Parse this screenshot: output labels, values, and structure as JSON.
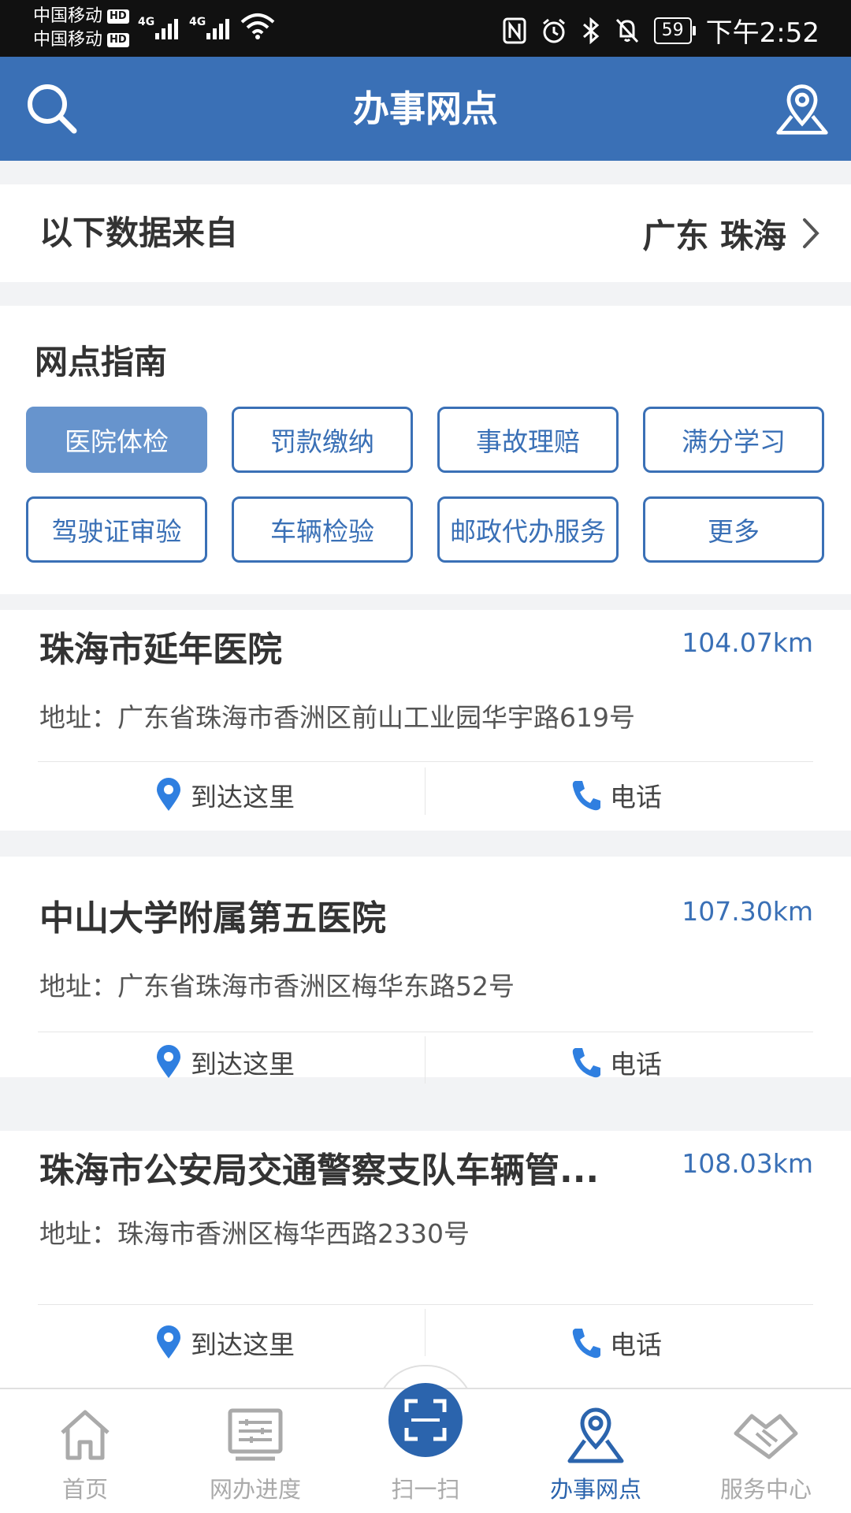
{
  "status_bar": {
    "carrier1": "中国移动",
    "carrier2": "中国移动",
    "hd": "HD",
    "net1": "4G",
    "net2": "4G",
    "battery": "59",
    "time": "下午2:52"
  },
  "header": {
    "title": "办事网点",
    "left_icon": "search-icon",
    "right_icon": "map-pin-icon",
    "bg_color": "#3a70b6"
  },
  "source": {
    "label": "以下数据来自",
    "location": "广东 珠海"
  },
  "guide": {
    "title": "网点指南",
    "chips": [
      "医院体检",
      "罚款缴纳",
      "事故理赔",
      "满分学习",
      "驾驶证审验",
      "车辆检验",
      "邮政代办服务",
      "更多"
    ],
    "active_chip": "医院体检"
  },
  "list": [
    {
      "name": "珠海市延年医院",
      "distance": "104.07km",
      "address": "地址：广东省珠海市香洲区前山工业园华宇路619号",
      "nav_label": "到达这里",
      "phone_label": "电话"
    },
    {
      "name": "中山大学附属第五医院",
      "distance": "107.30km",
      "address": "地址：广东省珠海市香洲区梅华东路52号",
      "nav_label": "到达这里",
      "phone_label": "电话"
    },
    {
      "name": "珠海市公安局交通警察支队车辆管...",
      "distance": "108.03km",
      "address": "地址：珠海市香洲区梅华西路2330号",
      "nav_label": "到达这里",
      "phone_label": "电话"
    }
  ],
  "bottom_nav": {
    "items": [
      {
        "label": "首页",
        "icon": "home-icon"
      },
      {
        "label": "网办进度",
        "icon": "progress-icon"
      },
      {
        "label": "扫一扫",
        "icon": "scan-icon"
      },
      {
        "label": "办事网点",
        "icon": "map-pin-icon"
      },
      {
        "label": "服务中心",
        "icon": "handshake-icon"
      }
    ],
    "active": "办事网点",
    "active_color": "#2b64ad"
  }
}
